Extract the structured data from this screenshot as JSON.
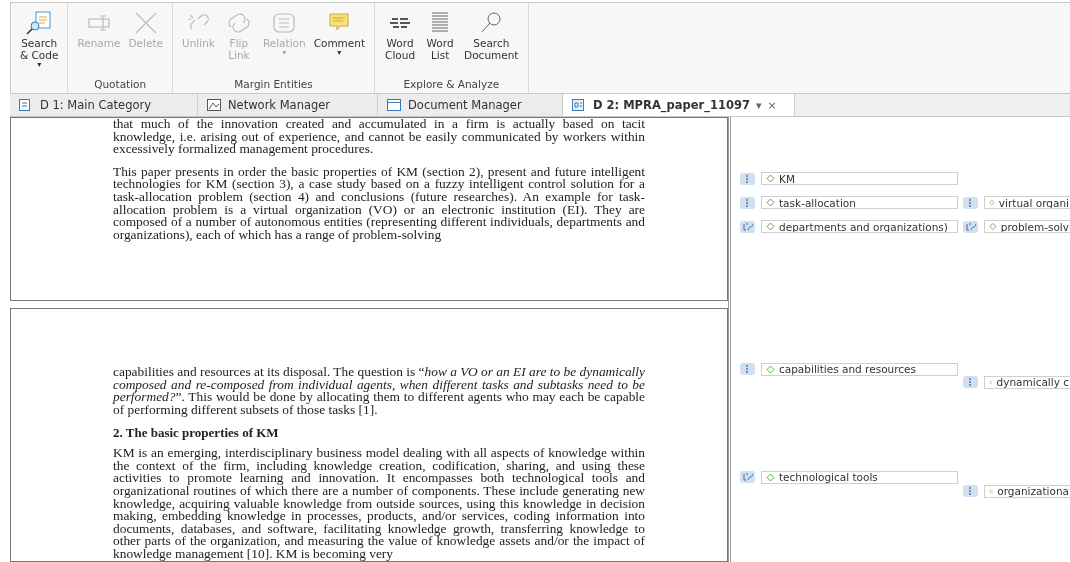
{
  "toolbar": {
    "groups": [
      {
        "buttons": [
          {
            "label": "Search\n& Code",
            "kind": "search-code",
            "disabled": false,
            "caret": "▾"
          }
        ]
      },
      {
        "label": "Quotation",
        "buttons": [
          {
            "label": "Rename",
            "kind": "rename",
            "disabled": true
          },
          {
            "label": "Delete",
            "kind": "delete",
            "disabled": true
          }
        ]
      },
      {
        "label": "Margin Entities",
        "buttons": [
          {
            "label": "Unlink",
            "kind": "unlink",
            "disabled": true
          },
          {
            "label": "Flip\nLink",
            "kind": "flip",
            "disabled": true
          },
          {
            "label": "Relation",
            "kind": "relation",
            "disabled": true,
            "caret": "▾"
          },
          {
            "label": "Comment",
            "kind": "comment",
            "disabled": false,
            "caret": "▾"
          }
        ]
      },
      {
        "label": "Explore & Analyze",
        "buttons": [
          {
            "label": "Word\nCloud",
            "kind": "cloud",
            "disabled": false
          },
          {
            "label": "Word\nList",
            "kind": "list",
            "disabled": false
          },
          {
            "label": "Search\nDocument",
            "kind": "search",
            "disabled": false
          }
        ]
      }
    ]
  },
  "tabs": [
    {
      "label": "D 1: Main Category",
      "kind": "doc",
      "selected": false
    },
    {
      "label": "Network Manager",
      "kind": "network",
      "selected": false
    },
    {
      "label": "Document Manager",
      "kind": "manager",
      "selected": false
    },
    {
      "label": "D 2: MPRA_paper_11097",
      "kind": "pdf",
      "selected": true,
      "menu": "▾",
      "close": "×"
    }
  ],
  "pages": [
    {
      "blocks": [
        {
          "kind": "paragraph",
          "text": "that much of the innovation created and accumulated in a firm is actually based on tacit knowledge, i.e. arising out of experience, and cannot be easily communicated by workers within excessively formalized management procedures."
        },
        {
          "kind": "paragraph",
          "text": "This paper presents in order the basic properties of KM (section 2), present and future intelligent technologies for KM (section 3), a case study based on a fuzzy intelligent control solution for a task-allocation problem (section 4) and conclusions (future researches). An example for task-allocation problem is a virtual organization (VO) or an electronic institution (EI). They are composed of a number of autonomous entities (representing different individuals, departments and organizations), each of which has a range of problem-solving"
        }
      ],
      "codes": [
        {
          "label": "KM",
          "kind": "quotation"
        },
        {
          "label": "task-allocation",
          "kind": "quotation"
        },
        {
          "label": "virtual organi",
          "kind": "quotation"
        },
        {
          "label": "departments and organizations)",
          "kind": "link"
        },
        {
          "label": "problem-solv",
          "kind": "link"
        }
      ]
    },
    {
      "blocks": [
        {
          "kind": "paragraph",
          "text": "capabilities and resources at its disposal. The question is “*how a VO or an EI are to be dynamically composed and re-composed from individual agents, when different tasks and subtasks need to be performed?*”. This would be done by allocating them to different agents who may each be capable of performing different subsets of those tasks [1]."
        },
        {
          "kind": "heading",
          "text": "2. The basic properties of KM"
        },
        {
          "kind": "paragraph",
          "text": "KM is an emerging, interdisciplinary business model dealing with all aspects of knowledge within the context of the firm, including knowledge creation, codification, sharing, and using these activities to promote learning and innovation. It encompasses both technological tools and organizational routines of which there are a number of components. These include generating new knowledge, acquiring valuable knowledge from outside sources, using this knowledge in decision making, embedding knowledge in processes, products, and/or services, coding information into documents, databases, and software, facilitating knowledge growth, transferring knowledge to other parts of the organization, and measuring the value of knowledge assets and/or the impact of knowledge management [10]. KM is becoming very"
        }
      ],
      "codes": [
        {
          "label": "capabilities and resources",
          "kind": "quotation"
        },
        {
          "label": "dynamically c",
          "kind": "quotation"
        },
        {
          "label": "technological tools",
          "kind": "link"
        },
        {
          "label": "organizationa",
          "kind": "quotation"
        }
      ]
    }
  ]
}
